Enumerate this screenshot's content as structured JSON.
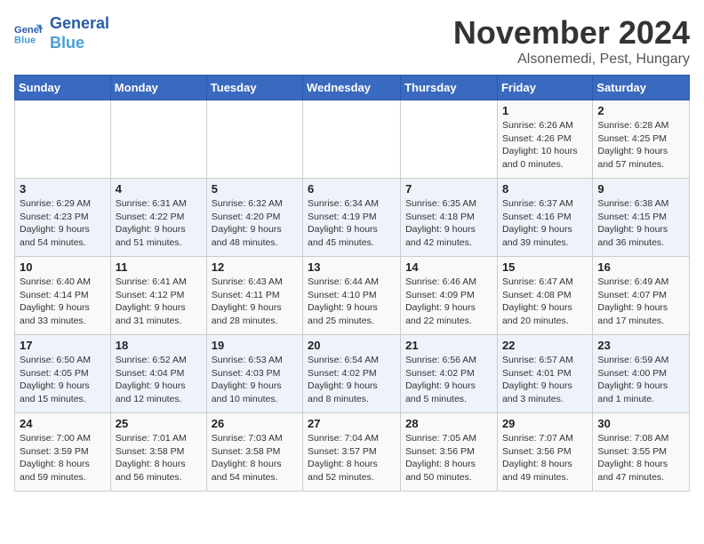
{
  "logo": {
    "line1": "General",
    "line2": "Blue"
  },
  "title": "November 2024",
  "location": "Alsonemedi, Pest, Hungary",
  "days_of_week": [
    "Sunday",
    "Monday",
    "Tuesday",
    "Wednesday",
    "Thursday",
    "Friday",
    "Saturday"
  ],
  "weeks": [
    [
      {
        "day": "",
        "info": ""
      },
      {
        "day": "",
        "info": ""
      },
      {
        "day": "",
        "info": ""
      },
      {
        "day": "",
        "info": ""
      },
      {
        "day": "",
        "info": ""
      },
      {
        "day": "1",
        "info": "Sunrise: 6:26 AM\nSunset: 4:26 PM\nDaylight: 10 hours\nand 0 minutes."
      },
      {
        "day": "2",
        "info": "Sunrise: 6:28 AM\nSunset: 4:25 PM\nDaylight: 9 hours\nand 57 minutes."
      }
    ],
    [
      {
        "day": "3",
        "info": "Sunrise: 6:29 AM\nSunset: 4:23 PM\nDaylight: 9 hours\nand 54 minutes."
      },
      {
        "day": "4",
        "info": "Sunrise: 6:31 AM\nSunset: 4:22 PM\nDaylight: 9 hours\nand 51 minutes."
      },
      {
        "day": "5",
        "info": "Sunrise: 6:32 AM\nSunset: 4:20 PM\nDaylight: 9 hours\nand 48 minutes."
      },
      {
        "day": "6",
        "info": "Sunrise: 6:34 AM\nSunset: 4:19 PM\nDaylight: 9 hours\nand 45 minutes."
      },
      {
        "day": "7",
        "info": "Sunrise: 6:35 AM\nSunset: 4:18 PM\nDaylight: 9 hours\nand 42 minutes."
      },
      {
        "day": "8",
        "info": "Sunrise: 6:37 AM\nSunset: 4:16 PM\nDaylight: 9 hours\nand 39 minutes."
      },
      {
        "day": "9",
        "info": "Sunrise: 6:38 AM\nSunset: 4:15 PM\nDaylight: 9 hours\nand 36 minutes."
      }
    ],
    [
      {
        "day": "10",
        "info": "Sunrise: 6:40 AM\nSunset: 4:14 PM\nDaylight: 9 hours\nand 33 minutes."
      },
      {
        "day": "11",
        "info": "Sunrise: 6:41 AM\nSunset: 4:12 PM\nDaylight: 9 hours\nand 31 minutes."
      },
      {
        "day": "12",
        "info": "Sunrise: 6:43 AM\nSunset: 4:11 PM\nDaylight: 9 hours\nand 28 minutes."
      },
      {
        "day": "13",
        "info": "Sunrise: 6:44 AM\nSunset: 4:10 PM\nDaylight: 9 hours\nand 25 minutes."
      },
      {
        "day": "14",
        "info": "Sunrise: 6:46 AM\nSunset: 4:09 PM\nDaylight: 9 hours\nand 22 minutes."
      },
      {
        "day": "15",
        "info": "Sunrise: 6:47 AM\nSunset: 4:08 PM\nDaylight: 9 hours\nand 20 minutes."
      },
      {
        "day": "16",
        "info": "Sunrise: 6:49 AM\nSunset: 4:07 PM\nDaylight: 9 hours\nand 17 minutes."
      }
    ],
    [
      {
        "day": "17",
        "info": "Sunrise: 6:50 AM\nSunset: 4:05 PM\nDaylight: 9 hours\nand 15 minutes."
      },
      {
        "day": "18",
        "info": "Sunrise: 6:52 AM\nSunset: 4:04 PM\nDaylight: 9 hours\nand 12 minutes."
      },
      {
        "day": "19",
        "info": "Sunrise: 6:53 AM\nSunset: 4:03 PM\nDaylight: 9 hours\nand 10 minutes."
      },
      {
        "day": "20",
        "info": "Sunrise: 6:54 AM\nSunset: 4:02 PM\nDaylight: 9 hours\nand 8 minutes."
      },
      {
        "day": "21",
        "info": "Sunrise: 6:56 AM\nSunset: 4:02 PM\nDaylight: 9 hours\nand 5 minutes."
      },
      {
        "day": "22",
        "info": "Sunrise: 6:57 AM\nSunset: 4:01 PM\nDaylight: 9 hours\nand 3 minutes."
      },
      {
        "day": "23",
        "info": "Sunrise: 6:59 AM\nSunset: 4:00 PM\nDaylight: 9 hours\nand 1 minute."
      }
    ],
    [
      {
        "day": "24",
        "info": "Sunrise: 7:00 AM\nSunset: 3:59 PM\nDaylight: 8 hours\nand 59 minutes."
      },
      {
        "day": "25",
        "info": "Sunrise: 7:01 AM\nSunset: 3:58 PM\nDaylight: 8 hours\nand 56 minutes."
      },
      {
        "day": "26",
        "info": "Sunrise: 7:03 AM\nSunset: 3:58 PM\nDaylight: 8 hours\nand 54 minutes."
      },
      {
        "day": "27",
        "info": "Sunrise: 7:04 AM\nSunset: 3:57 PM\nDaylight: 8 hours\nand 52 minutes."
      },
      {
        "day": "28",
        "info": "Sunrise: 7:05 AM\nSunset: 3:56 PM\nDaylight: 8 hours\nand 50 minutes."
      },
      {
        "day": "29",
        "info": "Sunrise: 7:07 AM\nSunset: 3:56 PM\nDaylight: 8 hours\nand 49 minutes."
      },
      {
        "day": "30",
        "info": "Sunrise: 7:08 AM\nSunset: 3:55 PM\nDaylight: 8 hours\nand 47 minutes."
      }
    ]
  ]
}
